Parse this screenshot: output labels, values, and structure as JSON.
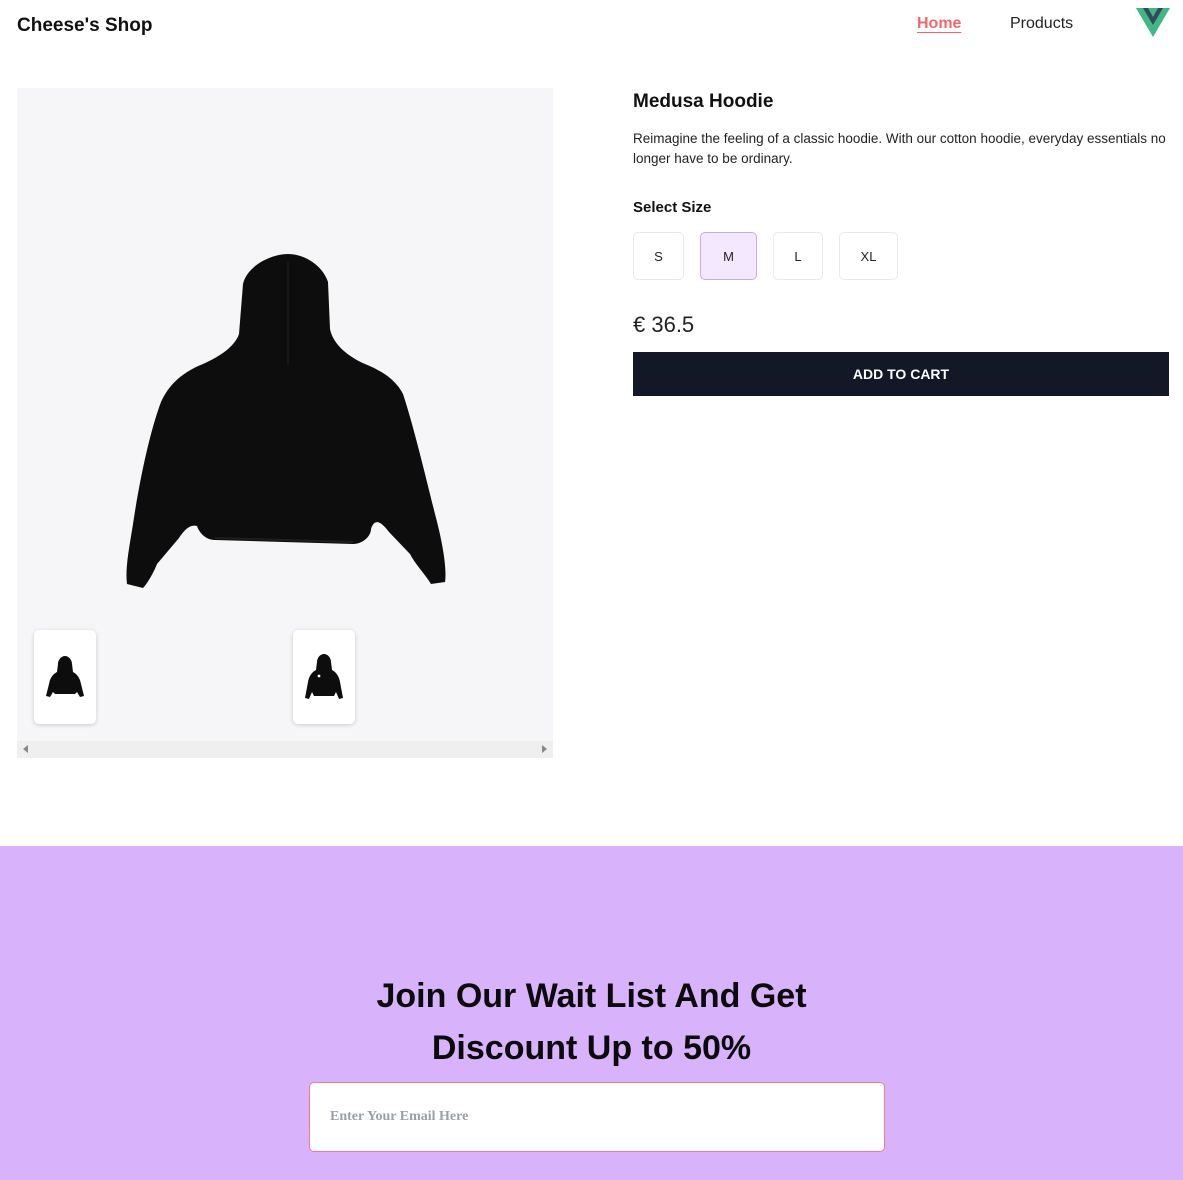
{
  "header": {
    "brand": "Cheese's Shop",
    "nav": {
      "home": "Home",
      "products": "Products"
    },
    "logo_icon": "vue-logo-icon",
    "accent_color": "#f0686e"
  },
  "product": {
    "title": "Medusa Hoodie",
    "description": "Reimagine the feeling of a classic hoodie. With our cotton hoodie, everyday essentials no longer have to be ordinary.",
    "size_label": "Select Size",
    "sizes": [
      "S",
      "M",
      "L",
      "XL"
    ],
    "selected_size": "M",
    "price": "€ 36.5",
    "add_to_cart": "ADD TO CART",
    "button_color": "#121826",
    "images": [
      "hoodie-back-image",
      "hoodie-front-image"
    ]
  },
  "waitlist": {
    "heading_line1": "Join Our Wait List And Get",
    "heading_line2": "Discount Up to 50%",
    "email_placeholder": "Enter Your Email Here",
    "background_color": "#d8b3fc"
  }
}
